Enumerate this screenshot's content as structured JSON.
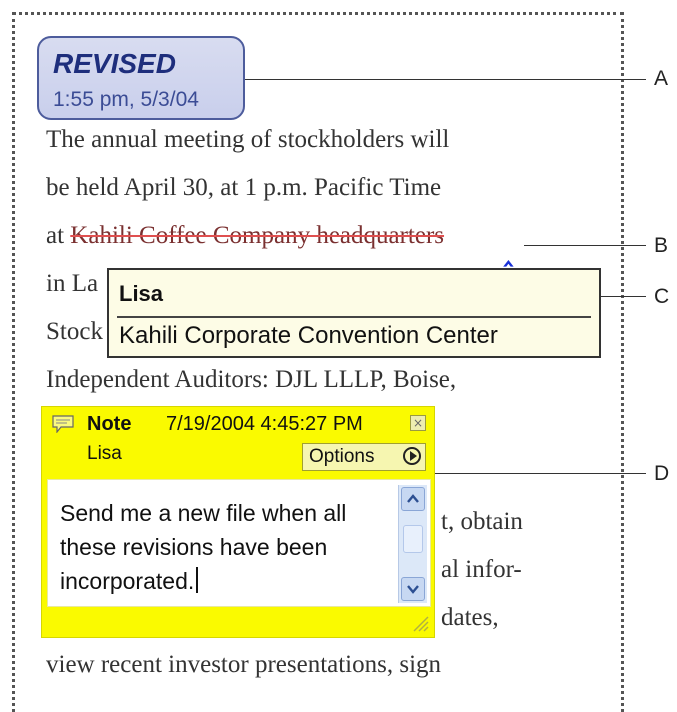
{
  "stamp": {
    "title": "REVISED",
    "date": "1:55 pm, 5/3/04"
  },
  "document": {
    "lines": [
      "The annual meeting of stockholders will",
      "be held April 30, at 1 p.m. Pacific Time",
      "at ",
      "in La",
      "Stock",
      "Independent Auditors: DJL LLLP, Boise,"
    ],
    "struck_text": "Kahili Coffee Company headquarters",
    "right_fragments": [
      "t, obtain",
      "al infor-",
      "dates,"
    ],
    "last_line": "view recent investor presentations, sign"
  },
  "insert_caret": "‸",
  "tooltip": {
    "author": "Lisa",
    "text": "Kahili Corporate Convention Center"
  },
  "note": {
    "title": "Note",
    "datetime": "7/19/2004 4:45:27 PM",
    "author": "Lisa",
    "options_label": "Options",
    "text": "Send me a new file when all these revisions have been incorporated.",
    "close_glyph": "×"
  },
  "callouts": [
    "A",
    "B",
    "C",
    "D"
  ],
  "colors": {
    "stamp_border": "#4d5c9c",
    "note_bg": "#fafa00",
    "tooltip_bg": "#fdfce6",
    "strike": "#e05050",
    "caret": "#1a32d8"
  }
}
